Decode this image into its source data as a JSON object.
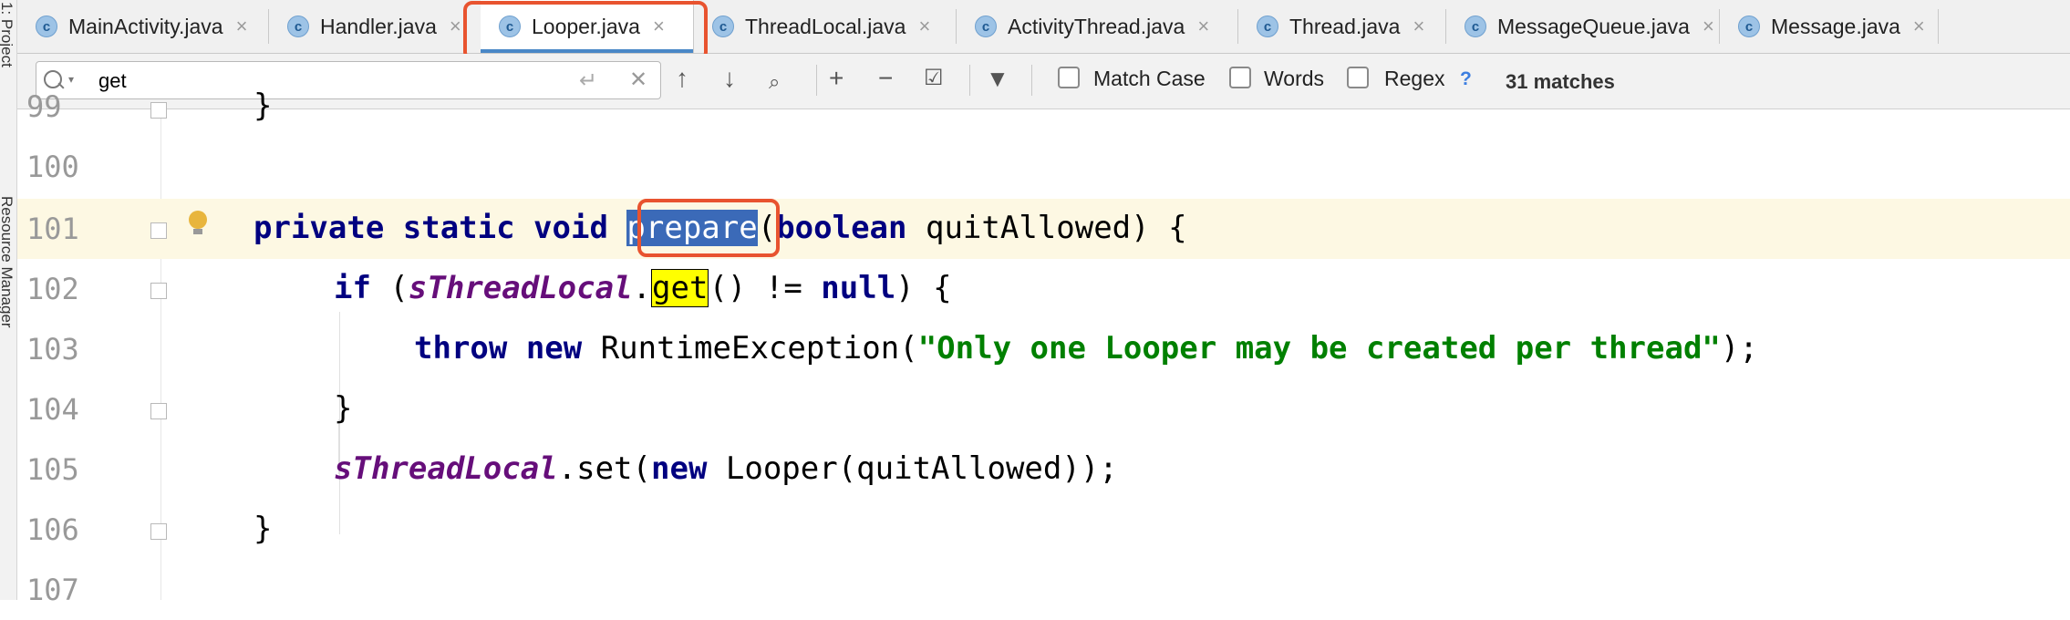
{
  "side_panel": {
    "labels": [
      "1: Project",
      "Resource Manager"
    ]
  },
  "tabs": [
    {
      "label": "MainActivity.java",
      "icon": "class-icon",
      "active": false
    },
    {
      "label": "Handler.java",
      "icon": "class-icon",
      "active": false
    },
    {
      "label": "Looper.java",
      "icon": "class-icon",
      "active": true
    },
    {
      "label": "ThreadLocal.java",
      "icon": "class-icon",
      "active": false
    },
    {
      "label": "ActivityThread.java",
      "icon": "class-icon",
      "active": false
    },
    {
      "label": "Thread.java",
      "icon": "class-icon",
      "active": false
    },
    {
      "label": "MessageQueue.java",
      "icon": "class-icon",
      "active": false
    },
    {
      "label": "Message.java",
      "icon": "class-icon",
      "active": false
    }
  ],
  "search": {
    "query": "get",
    "match_case_label": "Match Case",
    "words_label": "Words",
    "regex_label": "Regex",
    "help_label": "?",
    "match_count": "31 matches"
  },
  "editor": {
    "line_numbers": [
      "99",
      "100",
      "101",
      "102",
      "103",
      "104",
      "105",
      "106",
      "107"
    ],
    "code": {
      "l99": "}",
      "l101_kw": "private static void",
      "l101_name": "prepare",
      "l101_paren": "(",
      "l101_kw2": "boolean",
      "l101_rest": " quitAllowed) {",
      "l102_kw": "if",
      "l102_open": " (",
      "l102_field": "sThreadLocal",
      "l102_dot": ".",
      "l102_get": "get",
      "l102_mid": "() != ",
      "l102_null": "null",
      "l102_end": ") {",
      "l103_kw": "throw new",
      "l103_cls": " RuntimeException(",
      "l103_str": "\"Only one Looper may be created per thread\"",
      "l103_end": ");",
      "l104": "}",
      "l105_field": "sThreadLocal",
      "l105_set": ".set(",
      "l105_kw": "new",
      "l105_end": " Looper(quitAllowed));",
      "l106": "}"
    }
  },
  "colors": {
    "highlight_outline": "#e8532f",
    "keyword": "#000080",
    "static_field": "#660e7a",
    "string": "#008000",
    "selection": "#3b6ab8",
    "search_match": "#ffff00",
    "current_line": "#fdf8e3"
  }
}
